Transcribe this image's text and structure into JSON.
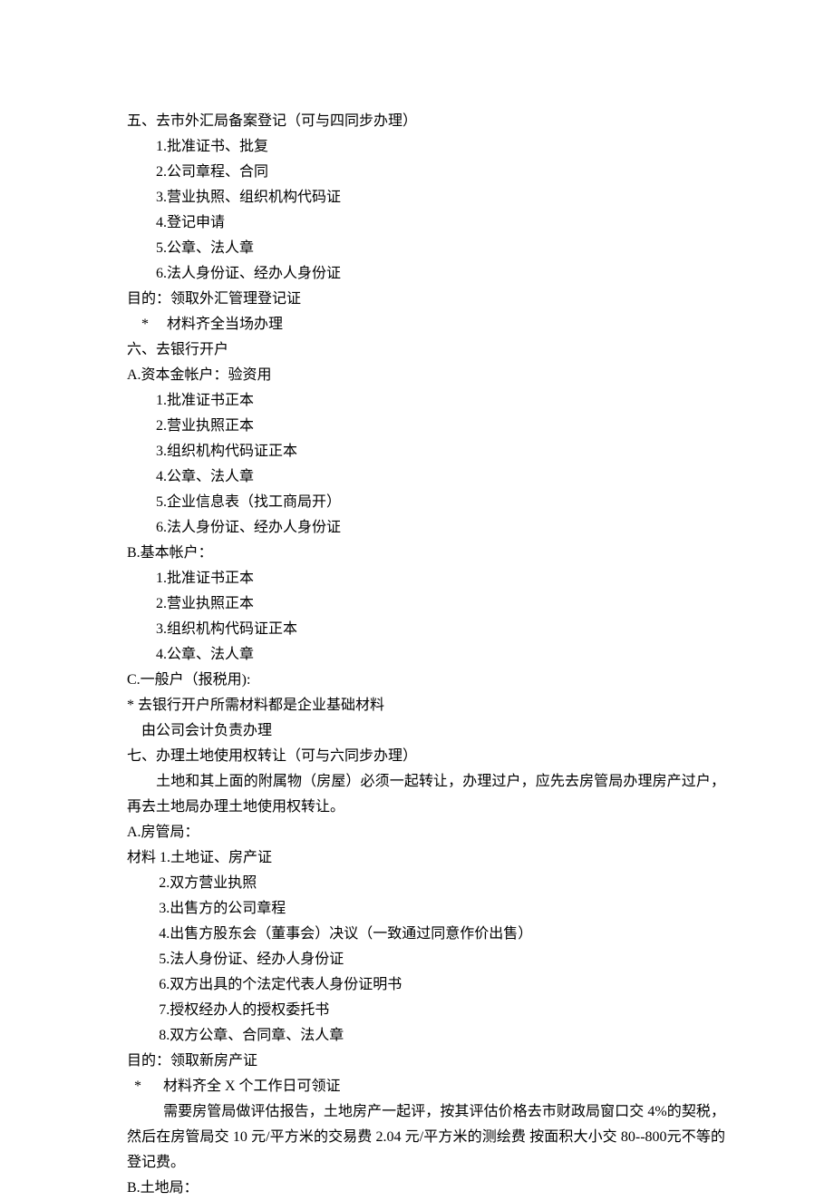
{
  "s5": {
    "title": "五、去市外汇局备案登记（可与四同步办理）",
    "items": [
      "1.批准证书、批复",
      "2.公司章程、合同",
      "3.营业执照、组织机构代码证",
      "4.登记申请",
      "5.公章、法人章",
      "6.法人身份证、经办人身份证"
    ],
    "purpose": "目的：领取外汇管理登记证",
    "note": "*　 材料齐全当场办理"
  },
  "s6": {
    "title": "六、去银行开户",
    "a_title": "A.资本金帐户：验资用",
    "a_items": [
      "1.批准证书正本",
      "2.营业执照正本",
      "3.组织机构代码证正本",
      "4.公章、法人章",
      "5.企业信息表（找工商局开）",
      "6.法人身份证、经办人身份证"
    ],
    "b_title": "B.基本帐户：",
    "b_items": [
      "1.批准证书正本",
      "2.营业执照正本",
      "3.组织机构代码证正本",
      "4.公章、法人章"
    ],
    "c_title": "C.一般户（报税用):",
    "note1": "*  去银行开户所需材料都是企业基础材料",
    "note2": "由公司会计负责办理"
  },
  "s7": {
    "title": "七、办理土地使用权转让（可与六同步办理）",
    "intro": "土地和其上面的附属物（房屋）必须一起转让，办理过户，应先去房管局办理房产过户，再去土地局办理土地使用权转让。",
    "a_title": "A.房管局：",
    "a_mat_label": "材料 1.土地证、房产证",
    "a_items": [
      "2.双方营业执照",
      "3.出售方的公司章程",
      "4.出售方股东会（董事会）决议（一致通过同意作价出售）",
      "5.法人身份证、经办人身份证",
      "6.双方出具的个法定代表人身份证明书",
      "7.授权经办人的授权委托书",
      "8.双方公章、合同章、法人章"
    ],
    "purpose": "目的：领取新房产证",
    "note_star": "  *　  材料齐全 X 个工作日可领证",
    "body": "需要房管局做评估报告，土地房产一起评，按其评估价格去市财政局窗口交 4%的契税，然后在房管局交 10 元/平方米的交易费 2.04 元/平方米的测绘费 按面积大小交 80--800元不等的登记费。",
    "b_title": "B.土地局："
  }
}
